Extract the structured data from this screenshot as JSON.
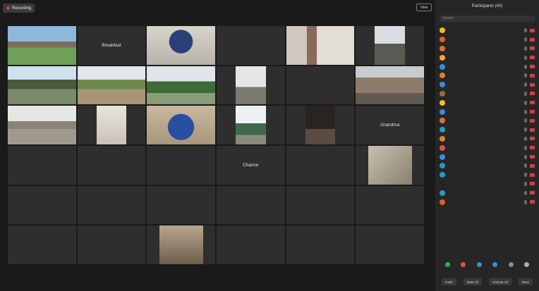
{
  "toolbar": {
    "recording_label": "Recording",
    "view_label": "View"
  },
  "panel": {
    "title": "Participants (40)",
    "search_placeholder": "Search"
  },
  "tiles": [
    {
      "type": "video",
      "scene": "yard"
    },
    {
      "type": "name",
      "name": "Breakfast"
    },
    {
      "type": "video",
      "scene": "face"
    },
    {
      "type": "empty"
    },
    {
      "type": "video",
      "scene": "hall"
    },
    {
      "type": "video",
      "scene": "outdoor"
    },
    {
      "type": "video",
      "scene": "sky"
    },
    {
      "type": "video",
      "scene": "field"
    },
    {
      "type": "video",
      "scene": "trees"
    },
    {
      "type": "video",
      "scene": "pole"
    },
    {
      "type": "empty"
    },
    {
      "type": "video",
      "scene": "garage"
    },
    {
      "type": "video",
      "scene": "lot"
    },
    {
      "type": "video",
      "scene": "portrait"
    },
    {
      "type": "video",
      "scene": "face2"
    },
    {
      "type": "video",
      "scene": "tree"
    },
    {
      "type": "video",
      "scene": "dark"
    },
    {
      "type": "name",
      "name": "Grandma"
    },
    {
      "type": "name",
      "name": ""
    },
    {
      "type": "name",
      "name": ""
    },
    {
      "type": "name",
      "name": ""
    },
    {
      "type": "name",
      "name": "Chance"
    },
    {
      "type": "name",
      "name": ""
    },
    {
      "type": "video",
      "scene": "dog"
    },
    {
      "type": "name",
      "name": ""
    },
    {
      "type": "name",
      "name": ""
    },
    {
      "type": "name",
      "name": ""
    },
    {
      "type": "name",
      "name": ""
    },
    {
      "type": "name",
      "name": ""
    },
    {
      "type": "name",
      "name": ""
    },
    {
      "type": "name",
      "name": ""
    },
    {
      "type": "name",
      "name": ""
    },
    {
      "type": "video",
      "scene": "room"
    },
    {
      "type": "name",
      "name": ""
    },
    {
      "type": "name",
      "name": ""
    },
    {
      "type": "name",
      "name": ""
    }
  ],
  "participants": [
    {
      "name": "",
      "color": "#f0c020"
    },
    {
      "name": "",
      "color": "#e06020"
    },
    {
      "name": "",
      "color": "#e07030"
    },
    {
      "name": "",
      "color": "#f0b020"
    },
    {
      "name": "",
      "color": "#3a8be0"
    },
    {
      "name": "",
      "color": "#e08030"
    },
    {
      "name": "",
      "color": "#3a8be0"
    },
    {
      "name": "",
      "color": "#9a6a40"
    },
    {
      "name": "",
      "color": "#f0c020"
    },
    {
      "name": "",
      "color": "#3a8be0"
    },
    {
      "name": "",
      "color": "#e07030"
    },
    {
      "name": "",
      "color": "#20a0c0"
    },
    {
      "name": "",
      "color": "#e08030"
    },
    {
      "name": "",
      "color": "#e05050"
    },
    {
      "name": "",
      "color": "#3a8be0"
    },
    {
      "name": "",
      "color": "#20a0c0"
    },
    {
      "name": "",
      "color": "#20a0c0"
    },
    {
      "name": "",
      "color": "#222222"
    },
    {
      "name": "",
      "color": "#20a0c0"
    },
    {
      "name": "",
      "color": "#e06030"
    }
  ],
  "reactions": [
    "#30b040",
    "#e05050",
    "#3a8be0",
    "#3a8be0",
    "#888888",
    "#aaaaaa"
  ],
  "footer": {
    "invite": "Invite",
    "mute_all": "Mute All",
    "unmute_all": "Unmute All",
    "more": "More"
  }
}
